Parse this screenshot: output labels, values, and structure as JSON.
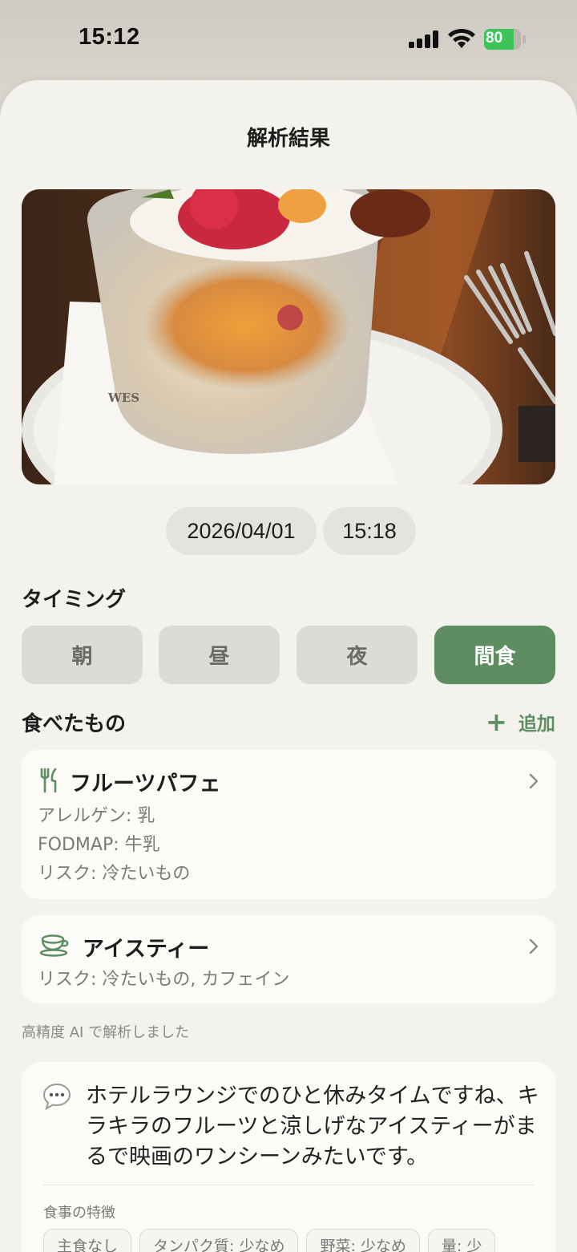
{
  "status_bar": {
    "time": "15:12",
    "battery_level": "80",
    "battery_color": "#3cc45a"
  },
  "sheet": {
    "title": "解析結果"
  },
  "photo": {
    "description_icon": "food-photo"
  },
  "datetime": {
    "date": "2026/04/01",
    "time": "15:18"
  },
  "timing": {
    "label": "タイミング",
    "options": [
      "朝",
      "昼",
      "夜",
      "間食"
    ],
    "selected": "間食",
    "accent": "#5f8d62"
  },
  "foods": {
    "label": "食べたもの",
    "add_label": "追加",
    "items": [
      {
        "icon": "fork-knife-icon",
        "name": "フルーツパフェ",
        "lines": [
          "アレルゲン: 乳",
          "FODMAP: 牛乳",
          "リスク: 冷たいもの"
        ]
      },
      {
        "icon": "cup-icon",
        "name": "アイスティー",
        "lines": [
          "リスク: 冷たいもの, カフェイン"
        ]
      }
    ]
  },
  "ai_note": "高精度 AI で解析しました",
  "comment": {
    "icon": "speech-bubble-icon",
    "text": "ホテルラウンジでのひと休みタイムですね、キラキラのフルーツと涼しげなアイスティーがまるで映画のワンシーンみたいです。",
    "features_label": "食事の特徴",
    "chips": [
      "主食なし",
      "タンパク質: 少なめ",
      "野菜: 少なめ",
      "量: 少"
    ]
  }
}
